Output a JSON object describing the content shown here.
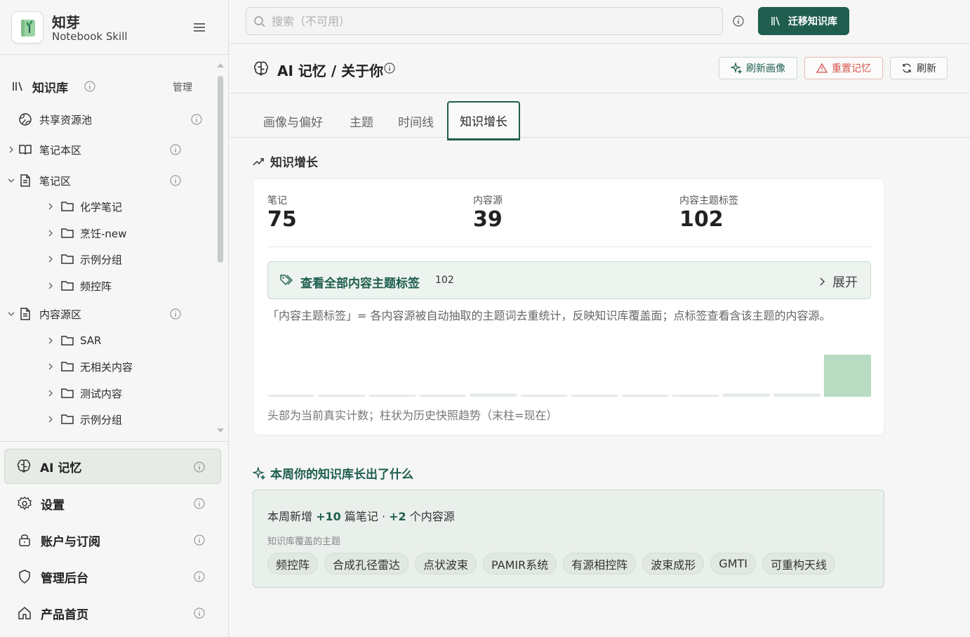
{
  "brand": {
    "name": "知芽",
    "subtitle": "Notebook Skill"
  },
  "sidebar": {
    "kb_title": "知识库",
    "manage_label": "管理",
    "tree": [
      {
        "label": "共享资源池",
        "level": 0,
        "icon": "globe-icon"
      },
      {
        "label": "笔记本区",
        "level": 0,
        "icon": "book-icon",
        "expanded": false
      },
      {
        "label": "笔记区",
        "level": 0,
        "icon": "doc-icon",
        "expanded": true
      },
      {
        "label": "化学笔记",
        "level": 1,
        "icon": "folder-icon"
      },
      {
        "label": "烹饪-new",
        "level": 1,
        "icon": "folder-icon"
      },
      {
        "label": "示例分组",
        "level": 1,
        "icon": "folder-icon"
      },
      {
        "label": "频控阵",
        "level": 1,
        "icon": "folder-icon"
      },
      {
        "label": "内容源区",
        "level": 0,
        "icon": "doc-icon",
        "expanded": true
      },
      {
        "label": "SAR",
        "level": 1,
        "icon": "folder-icon"
      },
      {
        "label": "无相关内容",
        "level": 1,
        "icon": "folder-icon"
      },
      {
        "label": "测试内容",
        "level": 1,
        "icon": "folder-icon"
      },
      {
        "label": "示例分组",
        "level": 1,
        "icon": "folder-icon"
      }
    ],
    "nav": [
      {
        "label": "AI 记忆",
        "icon": "brain-icon",
        "active": true
      },
      {
        "label": "设置",
        "icon": "gear-icon"
      },
      {
        "label": "账户与订阅",
        "icon": "lock-icon"
      },
      {
        "label": "管理后台",
        "icon": "shield-icon"
      },
      {
        "label": "产品首页",
        "icon": "home-icon"
      }
    ]
  },
  "topbar": {
    "search_placeholder": "搜索（不可用）",
    "migrate_label": "迁移知识库"
  },
  "page": {
    "title": "AI 记忆 / 关于你",
    "refresh_profile_label": "刷新画像",
    "reset_memory_label": "重置记忆",
    "refresh_label": "刷新"
  },
  "tabs": [
    "画像与偏好",
    "主题",
    "时间线",
    "知识增长"
  ],
  "growth": {
    "section_title": "知识增长",
    "stats": [
      {
        "label": "笔记",
        "value": "75"
      },
      {
        "label": "内容源",
        "value": "39"
      },
      {
        "label": "内容主题标签",
        "value": "102"
      }
    ],
    "tags_link": "查看全部内容主题标签",
    "tags_count": "102",
    "expand_label": "展开",
    "description": "「内容主题标签」= 各内容源被自动抽取的主题词去重统计，反映知识库覆盖面；点标签查看含该主题的内容源。",
    "trend": [
      0.05,
      0.05,
      0.05,
      0.05,
      0.08,
      0.05,
      0.05,
      0.05,
      0.05,
      0.08,
      0.08,
      1.0
    ],
    "footnote": "头部为当前真实计数；柱状为历史快照趋势（末柱=现在）"
  },
  "weekly": {
    "section_title": "本周你的知识库长出了什么",
    "line_prefix": "本周新增 ",
    "new_notes": "+10",
    "notes_unit": " 篇笔记 · ",
    "new_sources": "+2",
    "sources_unit": " 个内容源",
    "topics_label": "知识库覆盖的主题",
    "topics": [
      "频控阵",
      "合成孔径雷达",
      "点状波束",
      "PAMIR系统",
      "有源相控阵",
      "波束成形",
      "GMTI",
      "可重构天线"
    ]
  },
  "colors": {
    "accent": "#1f5e4f",
    "danger": "#d9534f",
    "bar": "#b8dcc1",
    "bar_faint": "#e4ebe5"
  }
}
